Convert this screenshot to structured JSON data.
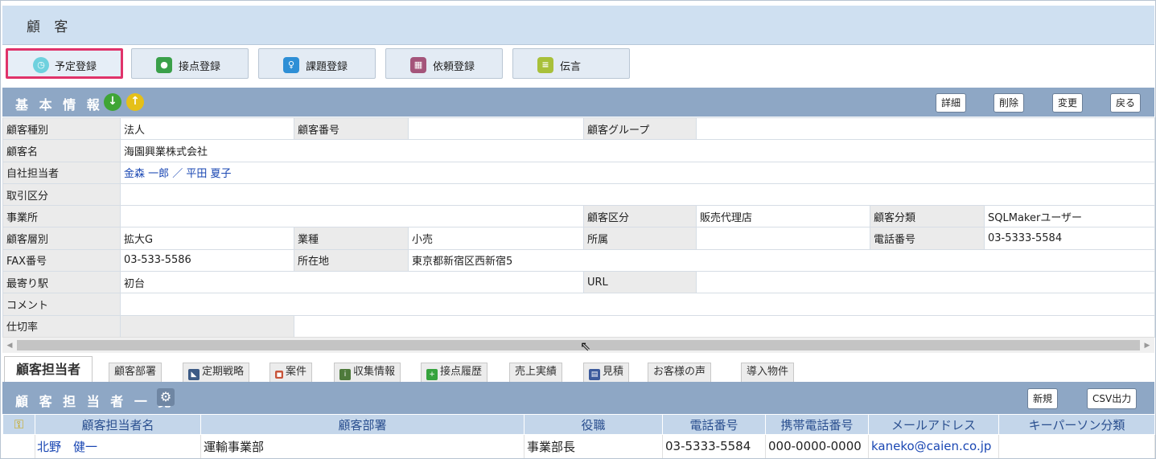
{
  "header": {
    "title": "顧 客"
  },
  "toolbar": {
    "buttons": [
      {
        "label": "予定登録",
        "icon": "clock-icon",
        "color": "#6fd1de"
      },
      {
        "label": "接点登録",
        "icon": "camera-icon",
        "color": "#3aa04a"
      },
      {
        "label": "課題登録",
        "icon": "pin-icon",
        "color": "#2e8fd6"
      },
      {
        "label": "依頼登録",
        "icon": "gift-icon",
        "color": "#a4547a"
      },
      {
        "label": "伝言",
        "icon": "message-icon",
        "color": "#a8c03a"
      }
    ]
  },
  "basic_info": {
    "title": "基 本 情 報",
    "actions": {
      "detail": "詳細",
      "delete": "削除",
      "edit": "変更",
      "back": "戻る"
    },
    "rows": {
      "customer_type_label": "顧客種別",
      "customer_type": "法人",
      "customer_no_label": "顧客番号",
      "customer_no": "",
      "customer_group_label": "顧客グループ",
      "customer_group": "",
      "customer_name_label": "顧客名",
      "customer_name": "海園興業株式会社",
      "staff_label": "自社担当者",
      "staff": "金森 一郎 ／ 平田 夏子",
      "trade_label": "取引区分",
      "trade": "",
      "office_label": "事業所",
      "office": "",
      "customer_class_label": "顧客区分",
      "customer_class": "販売代理店",
      "customer_category_label": "顧客分類",
      "customer_category": "SQLMakerユーザー",
      "layer_label": "顧客層別",
      "layer": "拡大G",
      "industry_label": "業種",
      "industry": "小売",
      "affiliation_label": "所属",
      "affiliation": "",
      "phone_label": "電話番号",
      "phone": "03-5333-5584",
      "fax_label": "FAX番号",
      "fax": "03-533-5586",
      "address_label": "所在地",
      "address": "東京都新宿区西新宿5",
      "station_label": "最寄り駅",
      "station": "初台",
      "url_label": "URL",
      "url": "",
      "comment_label": "コメント",
      "comment": "",
      "rate_label": "仕切率",
      "rate": ""
    }
  },
  "tabs": [
    {
      "label": "顧客担当者",
      "icon": ""
    },
    {
      "label": "顧客部署",
      "icon": ""
    },
    {
      "label": "定期戦略",
      "icon": "strategy-icon"
    },
    {
      "label": "案件",
      "icon": "briefcase-icon"
    },
    {
      "label": "収集情報",
      "icon": "info-icon"
    },
    {
      "label": "接点履歴",
      "icon": "history-icon"
    },
    {
      "label": "売上実績",
      "icon": ""
    },
    {
      "label": "見積",
      "icon": "estimate-icon"
    },
    {
      "label": "お客様の声",
      "icon": ""
    },
    {
      "label": "導入物件",
      "icon": ""
    }
  ],
  "contacts": {
    "title": "顧 客 担 当 者 一 覧",
    "new_label": "新規",
    "csv_label": "CSV出力",
    "columns": [
      "顧客担当者名",
      "顧客部署",
      "役職",
      "電話番号",
      "携帯電話番号",
      "メールアドレス",
      "キーパーソン分類"
    ],
    "rows": [
      {
        "name": "北野　健一",
        "dept": "運輸事業部",
        "title": "事業部長",
        "phone": "03-5333-5584",
        "mobile": "000-0000-0000",
        "email": "kaneko@caien.co.jp",
        "keyperson": ""
      }
    ]
  }
}
